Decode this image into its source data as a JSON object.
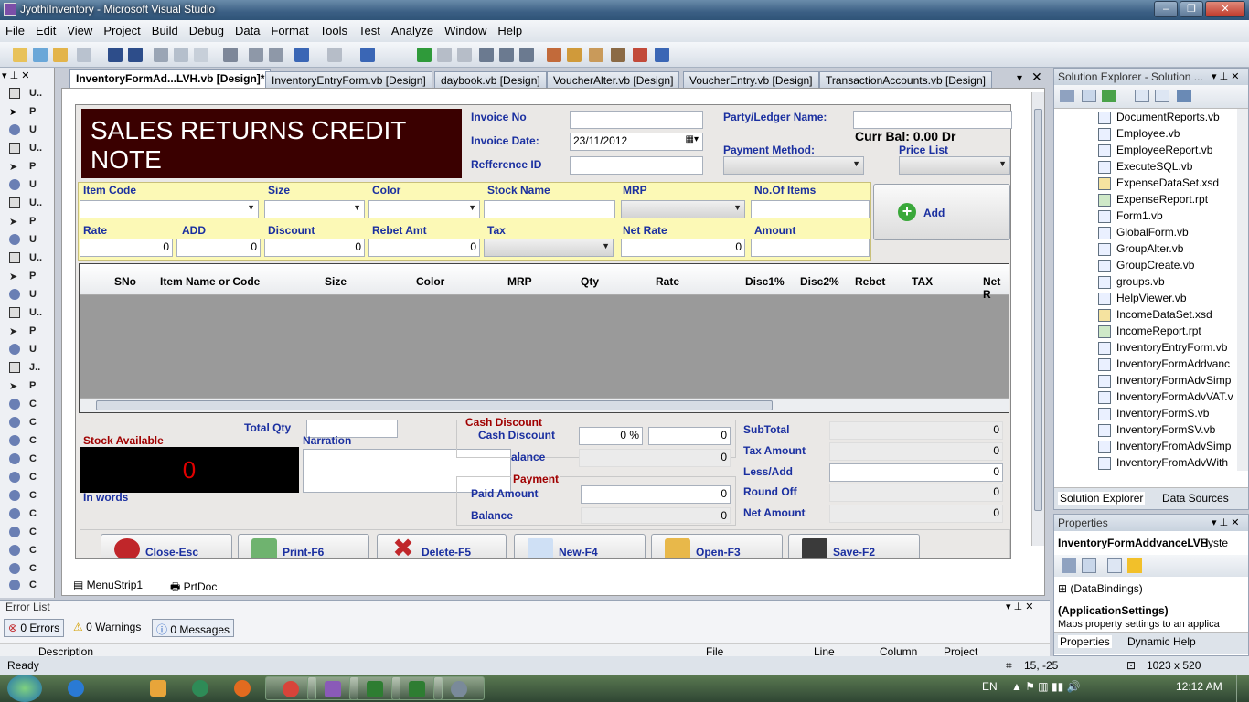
{
  "window": {
    "title": "JyothiInventory - Microsoft Visual Studio"
  },
  "menu": [
    "File",
    "Edit",
    "View",
    "Project",
    "Build",
    "Debug",
    "Data",
    "Format",
    "Tools",
    "Test",
    "Analyze",
    "Window",
    "Help"
  ],
  "toolbox": {
    "items": [
      "U..",
      "P",
      "U",
      "U..",
      "P",
      "U",
      "U..",
      "P",
      "U",
      "U..",
      "P",
      "U",
      "U..",
      "P",
      "U",
      "J..",
      "P",
      "C",
      "C",
      "C",
      "C",
      "C",
      "C",
      "C",
      "C",
      "C",
      "C",
      "C"
    ]
  },
  "tabs": [
    "InventoryFormAd...LVH.vb [Design]*",
    "InventoryEntryForm.vb [Design]",
    "daybook.vb [Design]",
    "VoucherAlter.vb [Design]",
    "VoucherEntry.vb [Design]",
    "TransactionAccounts.vb [Design]"
  ],
  "form": {
    "title": "SALES RETURNS CREDIT NOTE",
    "invoice_no_label": "Invoice No",
    "invoice_date_label": "Invoice Date:",
    "invoice_date_value": "23/11/2012",
    "reference_label": "Refference ID",
    "party_label": "Party/Ledger Name:",
    "curr_bal": "Curr Bal: 0.00 Dr",
    "payment_method_label": "Payment Method:",
    "price_list_label": "Price List",
    "entry_labels_row1": [
      "Item Code",
      "Size",
      "Color",
      "Stock Name",
      "MRP",
      "No.Of Items"
    ],
    "entry_labels_row2": [
      "Rate",
      "ADD",
      "Discount",
      "Rebet Amt",
      "Tax",
      "Net Rate",
      "Amount"
    ],
    "zero": "0",
    "add_button": "Add",
    "grid_columns": [
      "SNo",
      "Item Name or Code",
      "Size",
      "Color",
      "MRP",
      "Qty",
      "Rate",
      "Disc1%",
      "Disc2%",
      "Rebet",
      "TAX",
      "Net R"
    ],
    "total_qty_label": "Total Qty",
    "narration_label": "Narration",
    "stock_available_label": "Stock Available",
    "stock_value": "0",
    "in_words_label": "In words",
    "cash_discount_group": "Cash Discount",
    "cash_discount_label": "Cash Discount",
    "percent": "0 %",
    "balance_label_partial": "alance",
    "payment_group": "Payment",
    "paid_amount_label": "Paid Amount",
    "balance_label": "Balance",
    "subtotal_label": "SubTotal",
    "tax_amount_label": "Tax Amount",
    "less_add_label": "Less/Add",
    "round_off_label": "Round Off",
    "net_amount_label": "Net Amount",
    "buttons": [
      "Close-Esc",
      "Print-F6",
      "Delete-F5",
      "New-F4",
      "Open-F3",
      "Save-F2"
    ]
  },
  "components": [
    "MenuStrip1",
    "PrtDoc"
  ],
  "solution_explorer": {
    "title": "Solution Explorer - Solution ...",
    "files": [
      "DocumentReports.vb",
      "Employee.vb",
      "EmployeeReport.vb",
      "ExecuteSQL.vb",
      "ExpenseDataSet.xsd",
      "ExpenseReport.rpt",
      "Form1.vb",
      "GlobalForm.vb",
      "GroupAlter.vb",
      "GroupCreate.vb",
      "groups.vb",
      "HelpViewer.vb",
      "IncomeDataSet.xsd",
      "IncomeReport.rpt",
      "InventoryEntryForm.vb",
      "InventoryFormAddvanc",
      "InventoryFormAdvSimp",
      "InventoryFormAdvVAT.v",
      "InventoryFormS.vb",
      "InventoryFormSV.vb",
      "InventoryFromAdvSimp",
      "InventoryFromAdvWith"
    ],
    "tabs": [
      "Solution Explorer",
      "Data Sources"
    ]
  },
  "properties": {
    "title": "Properties",
    "object": "InventoryFormAddvanceLVH",
    "object_type": "Syste",
    "row1": "(DataBindings)",
    "row2": "(ApplicationSettings)",
    "desc": "Maps property settings to an applica",
    "tabs": [
      "Properties",
      "Dynamic Help"
    ]
  },
  "error_list": {
    "title": "Error List",
    "errors": "0 Errors",
    "warnings": "0 Warnings",
    "messages": "0 Messages",
    "columns": [
      "Description",
      "File",
      "Line",
      "Column",
      "Project"
    ]
  },
  "status": {
    "ready": "Ready",
    "position": "15, -25",
    "size": "1023 x 520"
  },
  "taskbar": {
    "lang": "EN",
    "time": "12:12 AM"
  }
}
